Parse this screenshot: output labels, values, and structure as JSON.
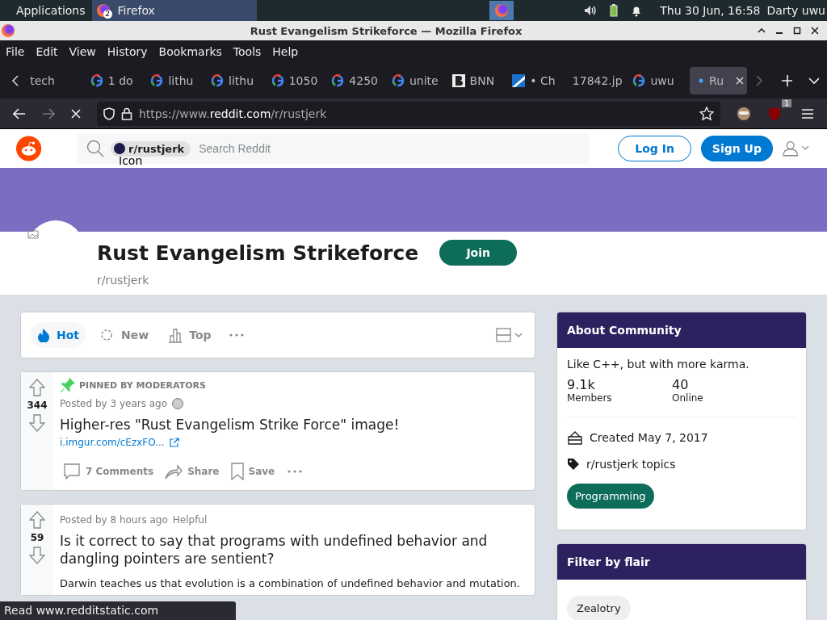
{
  "taskbar": {
    "apps_label": "Applications",
    "window_button": {
      "label": "Firefox",
      "badge": "2"
    },
    "clock": "Thu 30 Jun, 16:58",
    "user": "Darty uwu"
  },
  "window": {
    "title": "Rust Evangelism Strikeforce — Mozilla Firefox"
  },
  "menu": [
    "File",
    "Edit",
    "View",
    "History",
    "Bookmarks",
    "Tools",
    "Help"
  ],
  "tabs": [
    {
      "label": "tech",
      "kind": "plain",
      "selected": false
    },
    {
      "label": "1 do",
      "kind": "search",
      "selected": false
    },
    {
      "label": "lithu",
      "kind": "search",
      "selected": false
    },
    {
      "label": "lithu",
      "kind": "search",
      "selected": false
    },
    {
      "label": "1050",
      "kind": "search",
      "selected": false
    },
    {
      "label": "4250",
      "kind": "search",
      "selected": false
    },
    {
      "label": "unite",
      "kind": "search",
      "selected": false
    },
    {
      "label": "BNN",
      "kind": "letter",
      "selected": false
    },
    {
      "label": "• Ch",
      "kind": "stripe",
      "selected": false
    },
    {
      "label": "17842.jp",
      "kind": "plain",
      "selected": false
    },
    {
      "label": "uwu",
      "kind": "search",
      "selected": false
    },
    {
      "label": "Ru",
      "kind": "loading",
      "selected": true
    }
  ],
  "address": {
    "prefix": "https://www.",
    "domain": "reddit.com",
    "path": "/r/rustjerk",
    "extension_badge": "1"
  },
  "reddit_header": {
    "search_chip": "r/rustjerk",
    "chip_alt": "Icon",
    "placeholder": "Search Reddit",
    "login": "Log In",
    "signup": "Sign Up"
  },
  "community": {
    "name": "Rust Evangelism Strikeforce",
    "handle": "r/rustjerk",
    "join": "Join"
  },
  "sort": [
    {
      "label": "Hot",
      "selected": true
    },
    {
      "label": "New",
      "selected": false
    },
    {
      "label": "Top",
      "selected": false
    }
  ],
  "posts": [
    {
      "pinned_label": "PINNED BY MODERATORS",
      "votes": "344",
      "meta": "Posted by 3 years ago",
      "title": "Higher-res \"Rust Evangelism Strike Force\" image!",
      "link": "i.imgur.com/cEzxFO...",
      "actions": [
        "7 Comments",
        "Share",
        "Save"
      ]
    },
    {
      "votes": "59",
      "meta": "Posted by 8 hours ago",
      "flair": "Helpful",
      "title": "Is it correct to say that programs with undefined behavior and dangling pointers are sentient?",
      "body": "Darwin teaches us that evolution is a combination of undefined behavior and mutation."
    }
  ],
  "about": {
    "heading": "About Community",
    "description": "Like C++, but with more karma.",
    "stats": [
      {
        "value": "9.1k",
        "label": "Members"
      },
      {
        "value": "40",
        "label": "Online"
      }
    ],
    "created": "Created May 7, 2017",
    "topics": "r/rustjerk topics",
    "topic_tag": "Programming"
  },
  "flair_filter": {
    "heading": "Filter by flair",
    "flairs": [
      "Zealotry"
    ]
  },
  "status_bar": "Read www.redditstatic.com"
}
